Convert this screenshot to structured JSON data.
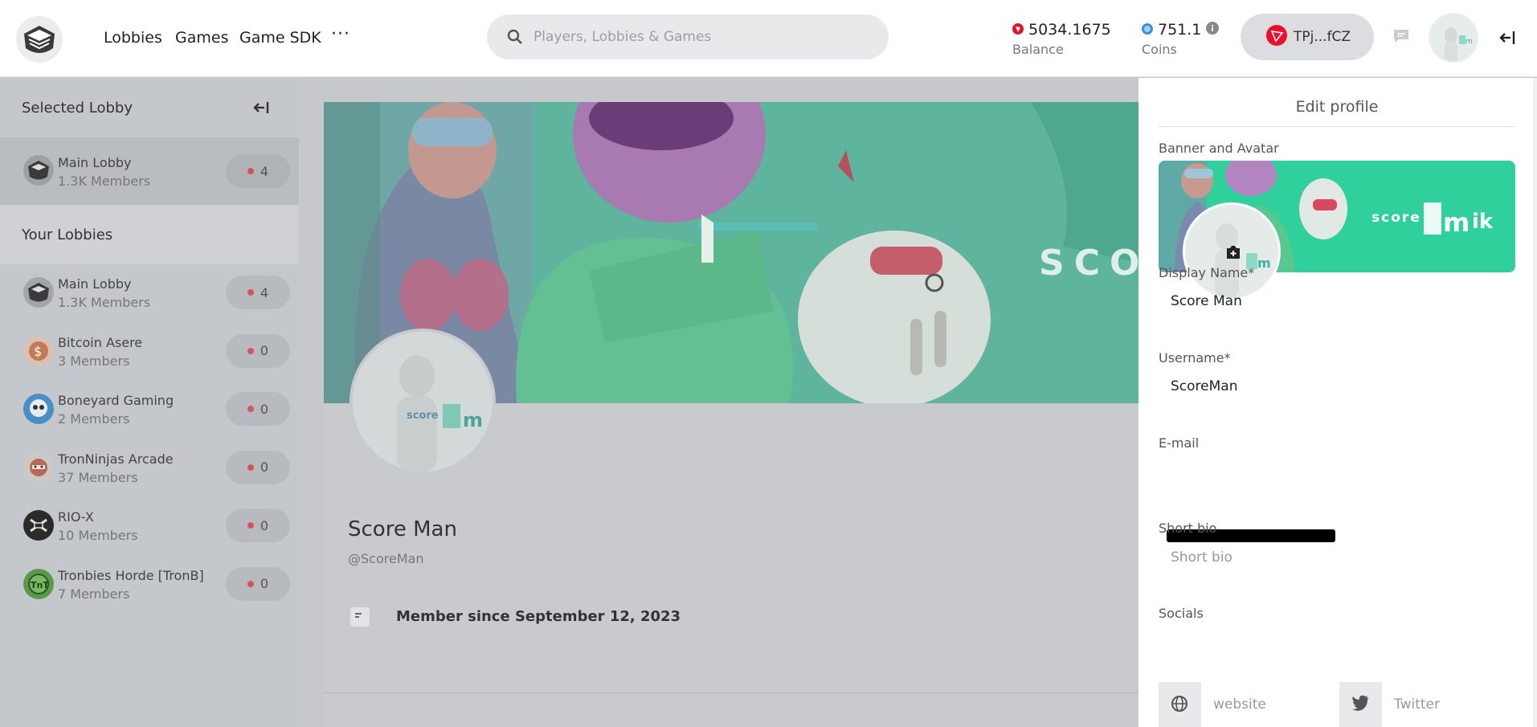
{
  "nav": {
    "lobbies": "Lobbies",
    "games": "Games",
    "sdk": "Game SDK",
    "more": "···"
  },
  "search": {
    "placeholder": "Players, Lobbies & Games"
  },
  "balance": {
    "value": "5034.1675",
    "label": "Balance"
  },
  "coins": {
    "value": "751.1",
    "label": "Coins"
  },
  "wallet": {
    "address": "TPj...fCZ"
  },
  "sidebar": {
    "selected_title": "Selected Lobby",
    "selected": {
      "name": "Main Lobby",
      "members": "1.3K Members",
      "count": "4"
    },
    "your_title": "Your Lobbies",
    "lobbies": [
      {
        "name": "Main Lobby",
        "members": "1.3K Members",
        "count": "4"
      },
      {
        "name": "Bitcoin Asere",
        "members": "3 Members",
        "count": "0"
      },
      {
        "name": "Boneyard Gaming",
        "members": "2 Members",
        "count": "0"
      },
      {
        "name": "TronNinjas Arcade",
        "members": "37 Members",
        "count": "0"
      },
      {
        "name": "RIO-X",
        "members": "10 Members",
        "count": "0"
      },
      {
        "name": "Tronbies Horde [TronB]",
        "members": "7 Members",
        "count": "0"
      }
    ]
  },
  "profile": {
    "name": "Score Man",
    "username": "@ScoreMan",
    "member_since": "Member since September 12, 2023",
    "banner_text": "SCO",
    "avatar_text": "score"
  },
  "edit": {
    "title": "Edit profile",
    "banner_label": "Banner and Avatar",
    "banner_text": "score",
    "display_label": "Display Name*",
    "display_value": "Score Man",
    "username_label": "Username*",
    "username_value": "ScoreMan",
    "email_label": "E-mail",
    "bio_label": "Short bio",
    "bio_placeholder": "Short bio",
    "socials_label": "Socials",
    "website_placeholder": "website",
    "twitter_placeholder": "Twitter"
  },
  "colors": {
    "accent_green": "#2fd09c",
    "status_red": "#d25460",
    "tron_red": "#e8112d"
  },
  "icons": [
    "logo-icon",
    "search-icon",
    "balance-icon",
    "coins-icon",
    "info-icon",
    "tron-icon",
    "chat-icon",
    "exit-icon",
    "collapse-icon",
    "calendar-icon",
    "camera-icon",
    "globe-icon",
    "twitter-icon"
  ]
}
